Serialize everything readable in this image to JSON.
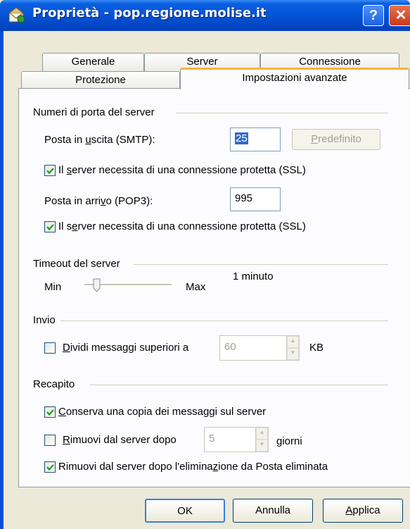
{
  "window": {
    "title": "Proprietà - pop.regione.molise.it",
    "help_label": "?",
    "close_label": "✕",
    "icon": "mail-account-icon"
  },
  "tabs": {
    "row_top": [
      "Generale",
      "Server",
      "Connessione"
    ],
    "row_bottom": [
      "Protezione",
      "Impostazioni avanzate"
    ],
    "active": "Impostazioni avanzate"
  },
  "ports": {
    "group_label": "Numeri di porta del server",
    "smtp_label_pre": "Posta in ",
    "smtp_label_u": "u",
    "smtp_label_post": "scita (SMTP):",
    "smtp_value": "25",
    "default_button_pre": "",
    "default_button_u": "P",
    "default_button_post": "redefinito",
    "ssl_smtp_pre": "Il ",
    "ssl_smtp_u": "s",
    "ssl_smtp_post": "erver necessita di una connessione protetta (SSL)",
    "ssl_smtp_checked": true,
    "pop3_label_pre": "Posta in arri",
    "pop3_label_u": "v",
    "pop3_label_post": "o (POP3):",
    "pop3_value": "995",
    "ssl_pop3_pre": "Il s",
    "ssl_pop3_u": "e",
    "ssl_pop3_post": "rver necessita di una connessione protetta (SSL)",
    "ssl_pop3_checked": true
  },
  "timeout": {
    "group_label": "Timeout del server",
    "min_label": "Min",
    "max_label": "Max",
    "value_label": "1 minuto",
    "slider_level": 0.14
  },
  "send": {
    "group_label": "Invio",
    "split_label_pre": "",
    "split_label_u": "D",
    "split_label_post": "ividi messaggi superiori a",
    "split_checked": false,
    "split_value": "60",
    "split_unit": "KB"
  },
  "delivery": {
    "group_label": "Recapito",
    "keep_copy_pre": "",
    "keep_copy_u": "C",
    "keep_copy_post": "onserva una copia dei messaggi sul server",
    "keep_copy_checked": true,
    "remove_after_pre": "",
    "remove_after_u": "R",
    "remove_after_post": "imuovi dal server dopo",
    "remove_after_checked": false,
    "remove_after_value": "5",
    "remove_after_unit": "giorni",
    "remove_deleted_pre": "Rimuovi dal server dopo l'elimina",
    "remove_deleted_u": "z",
    "remove_deleted_post": "ione da Posta eliminata",
    "remove_deleted_checked": true
  },
  "footer": {
    "ok_label": "OK",
    "cancel_label": "Annulla",
    "apply_label_pre": "",
    "apply_label_u": "A",
    "apply_label_post": "pplica"
  }
}
